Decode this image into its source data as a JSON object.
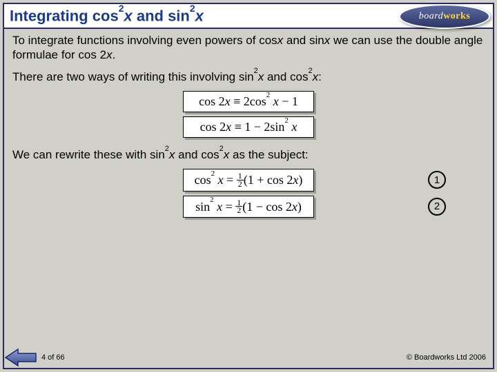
{
  "title": {
    "prefix": "Integrating cos",
    "sup1": "2",
    "mid1": "x",
    "conj": " and sin",
    "sup2": "2",
    "mid2": "x"
  },
  "logo": {
    "brand_prefix": "board",
    "brand_suffix": "works"
  },
  "body": {
    "p1a": "To integrate functions involving even powers of cos",
    "p1b": "x",
    "p1c": " and sin",
    "p1d": "x",
    "p1e": " we can use the double angle formulae for cos 2",
    "p1f": "x",
    "p1g": ".",
    "p2a": "There are two ways of writing this involving sin",
    "p2sup1": "2",
    "p2b": "x",
    "p2c": " and cos",
    "p2sup2": "2",
    "p2d": "x",
    "p2e": ":",
    "p3a": "We can rewrite these with sin",
    "p3sup1": "2",
    "p3b": "x",
    "p3c": " and cos",
    "p3sup2": "2",
    "p3d": "x",
    "p3e": " as the subject:"
  },
  "formulas": {
    "f1": {
      "lhs": "cos 2",
      "lvar": "x",
      "eq": " ≡ 2cos",
      "sup": "2",
      "rvar": " x",
      "tail": " − 1"
    },
    "f2": {
      "lhs": "cos 2",
      "lvar": "x",
      "eq": " ≡ 1 − 2sin",
      "sup": "2",
      "rvar": " x",
      "tail": ""
    },
    "f3": {
      "lhs": "cos",
      "lsup": "2",
      "lvar": " x",
      "eq": " = ",
      "half_n": "1",
      "half_d": "2",
      "paren": "(1 + cos 2",
      "pvar": "x",
      "close": ")"
    },
    "f4": {
      "lhs": "sin",
      "lsup": "2",
      "lvar": " x",
      "eq": " = ",
      "half_n": "1",
      "half_d": "2",
      "paren": "(1 − cos 2",
      "pvar": "x",
      "close": ")"
    }
  },
  "labels": {
    "num1": "1",
    "num2": "2"
  },
  "footer": {
    "page": "4 of 66",
    "copyright": "© Boardworks Ltd 2006"
  }
}
